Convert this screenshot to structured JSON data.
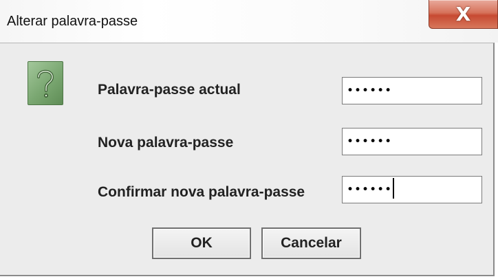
{
  "window": {
    "title": "Alterar palavra-passe",
    "close_glyph": "X"
  },
  "icons": {
    "help": "question-icon"
  },
  "fields": {
    "current": {
      "label": "Palavra-passe actual",
      "masked_value": "••••••"
    },
    "new": {
      "label": "Nova palavra-passe",
      "masked_value": "••••••"
    },
    "confirm": {
      "label": "Confirmar nova palavra-passe",
      "masked_value": "••••••"
    }
  },
  "buttons": {
    "ok": "OK",
    "cancel": "Cancelar"
  },
  "colors": {
    "dialog_bg": "#ececec",
    "close_button": "#c74a32",
    "help_icon": "#7aa771"
  }
}
